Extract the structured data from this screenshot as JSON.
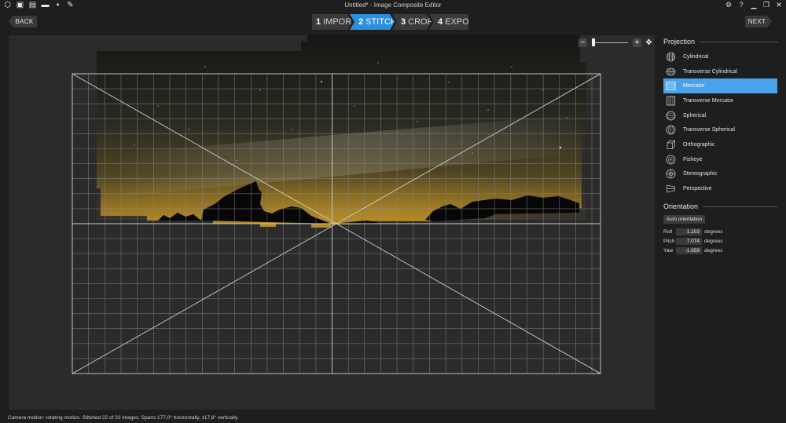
{
  "window": {
    "title": "Untitled* - Image Composite Editor"
  },
  "workflow": {
    "back_label": "BACK",
    "next_label": "NEXT",
    "steps": [
      {
        "num": "1",
        "label": "IMPORT"
      },
      {
        "num": "2",
        "label": "STITCH"
      },
      {
        "num": "3",
        "label": "CROP"
      },
      {
        "num": "4",
        "label": "EXPORT"
      }
    ],
    "active_step": 2
  },
  "zoom": {
    "minus": "−",
    "plus": "+",
    "level": 0.0
  },
  "projection": {
    "heading": "Projection",
    "items": [
      {
        "label": "Cylindrical",
        "icon": "cylindrical-icon"
      },
      {
        "label": "Transverse Cylindrical",
        "icon": "transverse-cylindrical-icon"
      },
      {
        "label": "Mercator",
        "icon": "mercator-icon"
      },
      {
        "label": "Transverse Mercator",
        "icon": "transverse-mercator-icon"
      },
      {
        "label": "Spherical",
        "icon": "spherical-icon"
      },
      {
        "label": "Transverse Spherical",
        "icon": "transverse-spherical-icon"
      },
      {
        "label": "Orthographic",
        "icon": "orthographic-icon"
      },
      {
        "label": "Fisheye",
        "icon": "fisheye-icon"
      },
      {
        "label": "Stereographic",
        "icon": "stereographic-icon"
      },
      {
        "label": "Perspective",
        "icon": "perspective-icon"
      }
    ],
    "selected": "Mercator"
  },
  "orientation": {
    "heading": "Orientation",
    "auto_label": "Auto orientation",
    "unit": "degrees",
    "roll": {
      "label": "Roll",
      "value": "1.103"
    },
    "pitch": {
      "label": "Pitch",
      "value": "7.074"
    },
    "yaw": {
      "label": "Yaw",
      "value": "-1.659"
    }
  },
  "status": {
    "text": "Camera motion: rotating motion. Stitched 22 of 22 images. Spans 177,0° horizontally, 117,8° vertically."
  },
  "colors": {
    "accent": "#2d8ee0",
    "selected": "#4aa3ea",
    "background": "#1e1e1e",
    "canvas": "#2b2b2b"
  }
}
